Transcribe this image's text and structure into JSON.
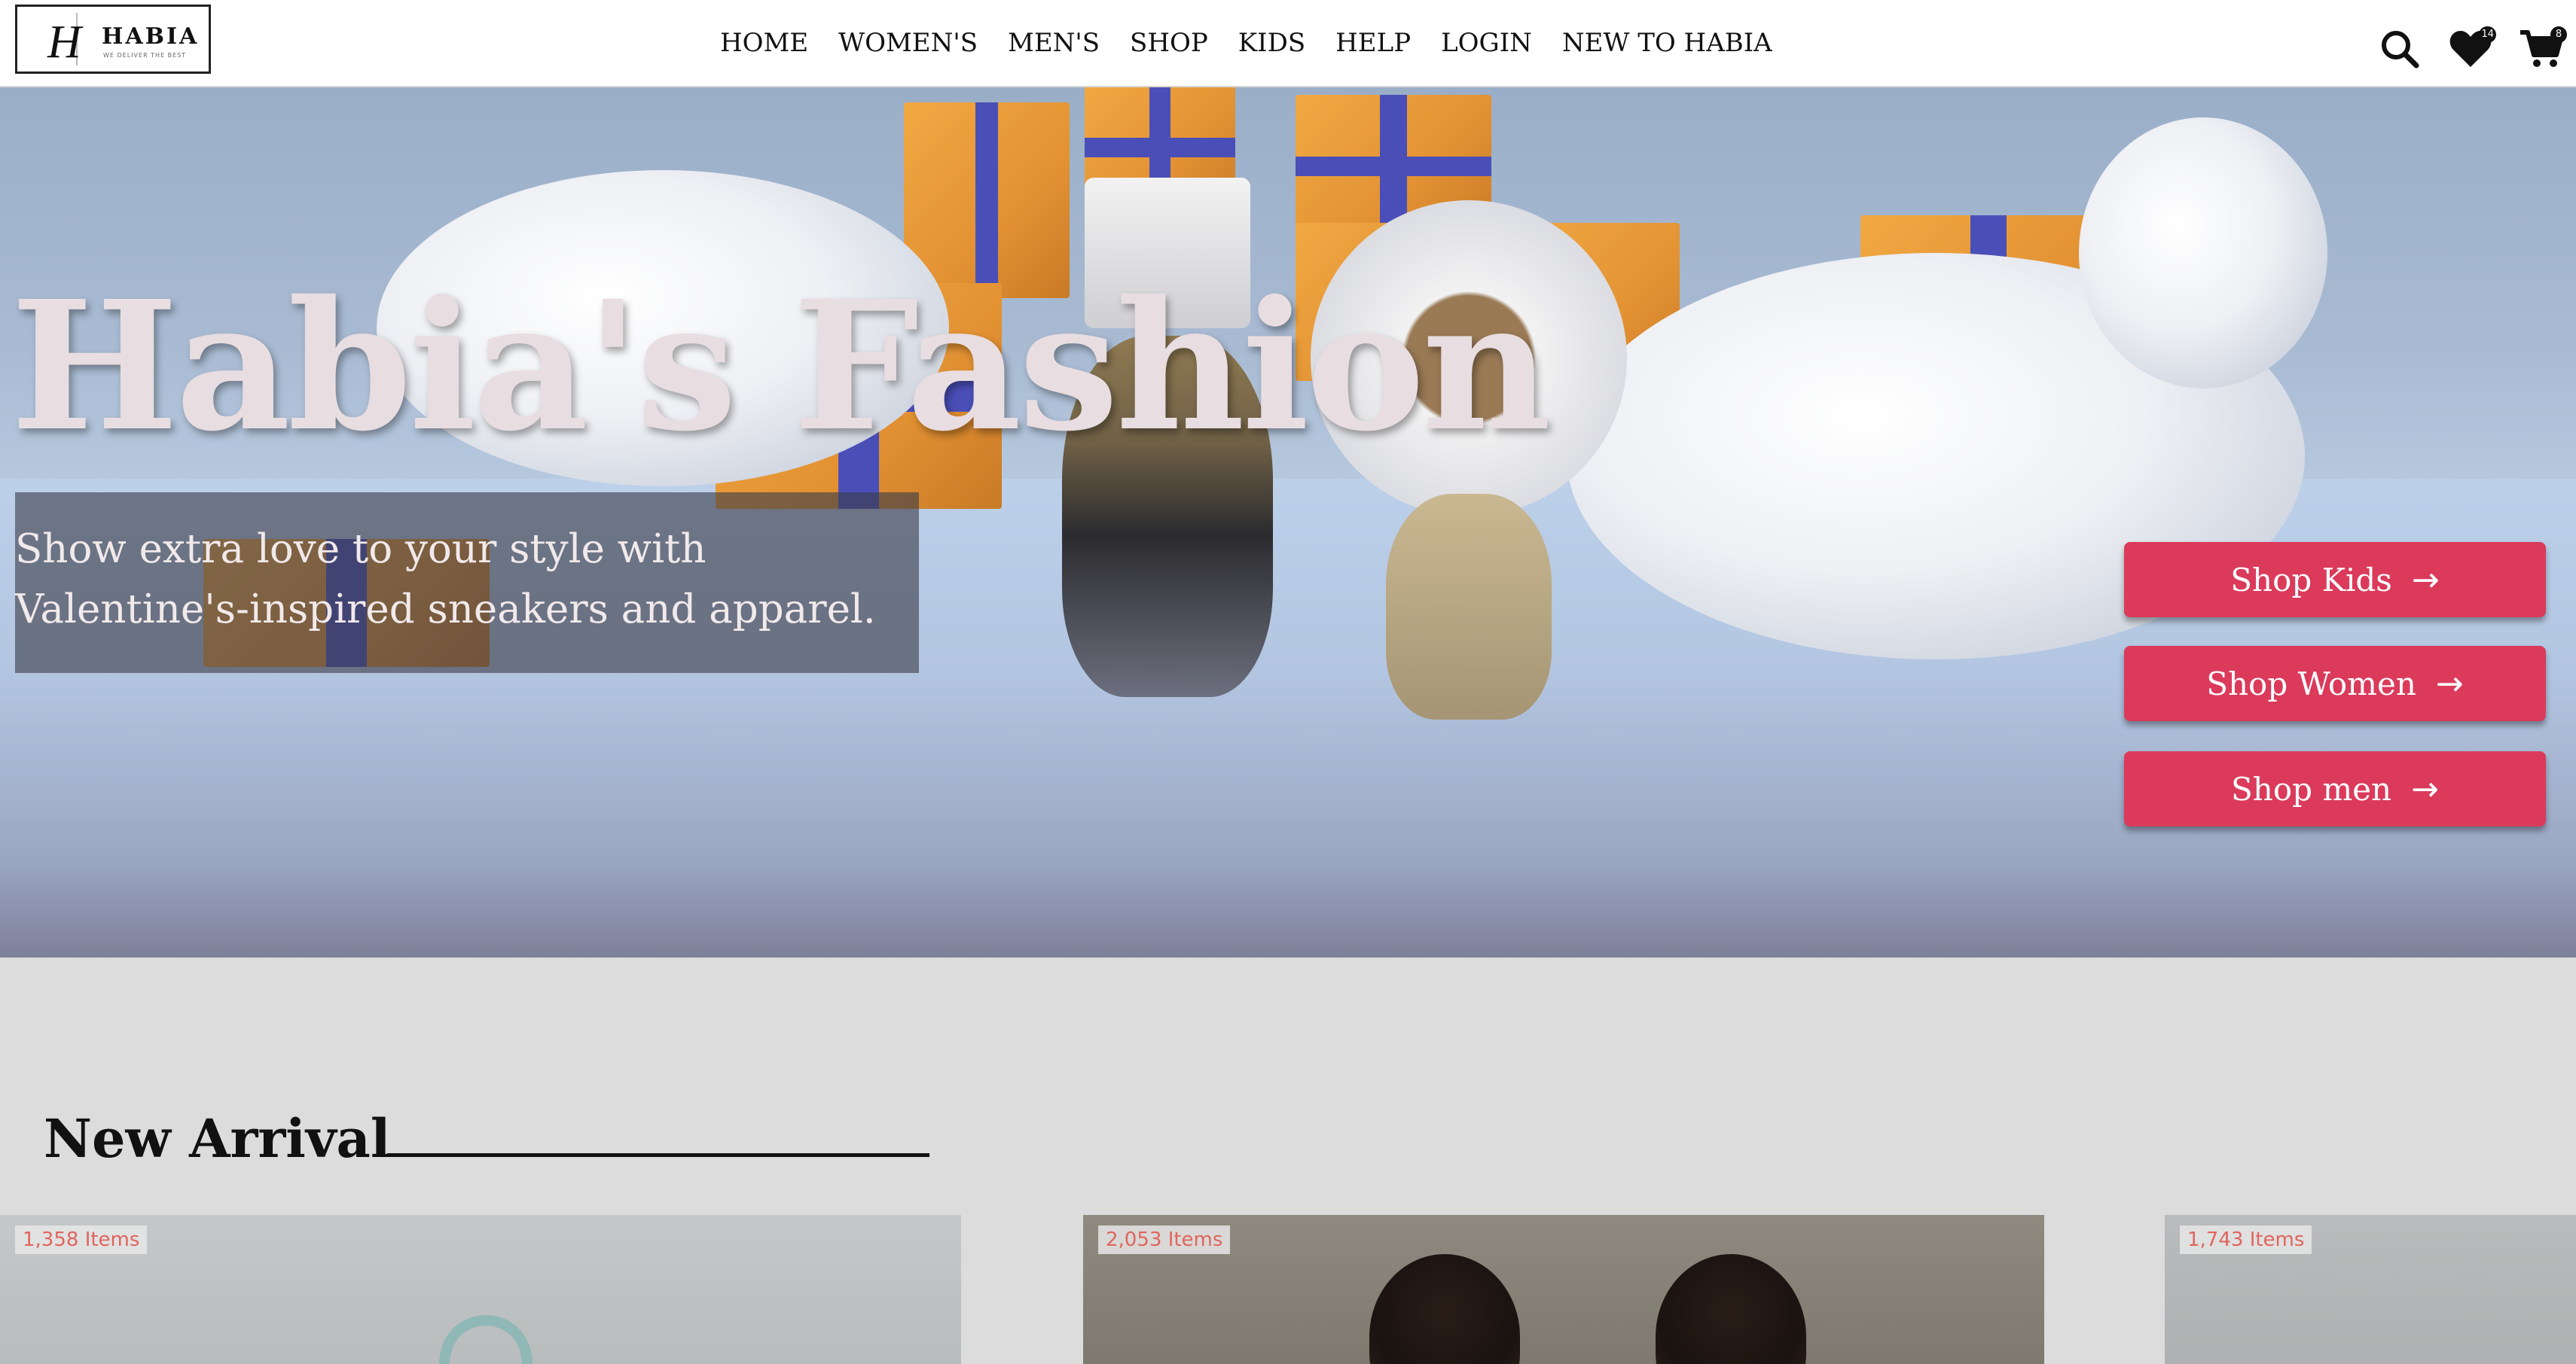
{
  "brand": {
    "letter": "H",
    "name": "HABIA",
    "tagline": "WE DELIVER THE BEST"
  },
  "nav": {
    "links": [
      "HOME",
      "WOMEN'S",
      "MEN'S",
      "SHOP",
      "KIDS",
      "HELP",
      "LOGIN",
      "NEW TO HABIA"
    ]
  },
  "icons": {
    "search": "search-icon",
    "wishlist": "heart-icon",
    "cart": "cart-icon",
    "wishlist_count": "14",
    "cart_count": "8"
  },
  "hero": {
    "title": "Habia's Fashion",
    "subtitle": "Show extra love to your style with Valentine's-inspired sneakers and apparel.",
    "buttons": [
      {
        "label": "Shop Kids",
        "arrow": "→"
      },
      {
        "label": "Shop Women",
        "arrow": "→"
      },
      {
        "label": "Shop men",
        "arrow": "→"
      }
    ]
  },
  "new_arrival": {
    "title": "New Arrival",
    "cards": [
      {
        "count": "1,358 Items"
      },
      {
        "count": "2,053 Items"
      },
      {
        "count": "1,743 Items"
      }
    ]
  },
  "colors": {
    "accent": "#db3a5b",
    "badge_text": "#e0655e",
    "section_bg": "#dcdcdc"
  }
}
